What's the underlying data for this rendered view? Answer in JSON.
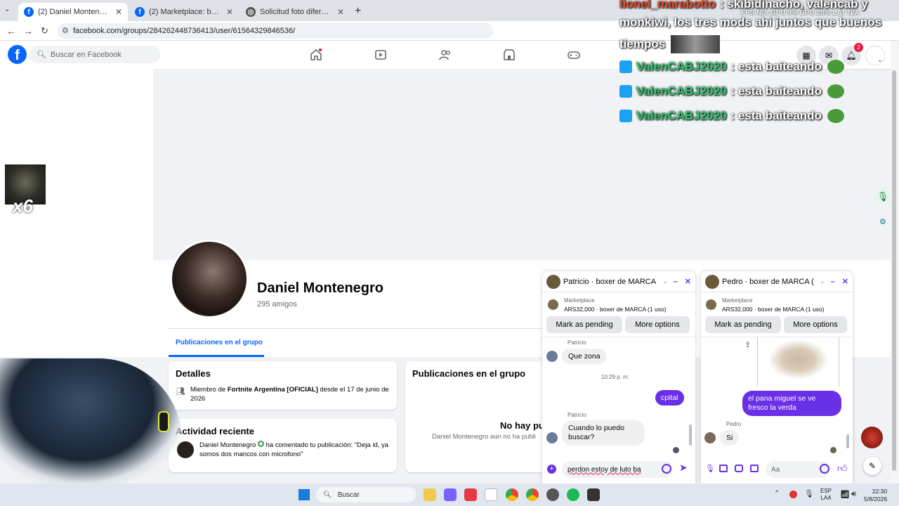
{
  "browser": {
    "tabs": [
      {
        "title": "(2) Daniel Montenegro | Facebook",
        "active": true
      },
      {
        "title": "(2) Marketplace: boxer de MARCA",
        "active": false
      },
      {
        "title": "Solicitud foto diferente",
        "active": false
      }
    ],
    "url": "facebook.com/groups/284262448736413/user/61564329846536/"
  },
  "fb": {
    "search_placeholder": "Buscar en Facebook",
    "notif_count": "2",
    "accent": "#0866ff"
  },
  "profile": {
    "name": "Daniel Montenegro",
    "friends": "295 amigos",
    "tab_active": "Publicaciones en el grupo"
  },
  "details": {
    "title": "Detalles",
    "member_prefix": "Miembro de ",
    "member_group": "Fortnite Argentina [OFICIAL]",
    "member_suffix": " desde el 17 de junio de 2026"
  },
  "activity": {
    "title": "Actividad reciente",
    "actor": "Daniel Montenegro",
    "action": " ha comentado tu publicación: \"Deja id, ya somos dos mancos con microfono\""
  },
  "posts": {
    "title": "Publicaciones en el grupo",
    "empty_title": "No hay pu",
    "empty_sub": "Daniel Montenegro aún no ha publi"
  },
  "chat1": {
    "title": "Patricio · boxer de MARCA...",
    "market_label": "Marketplace",
    "market_item": "ARS32,000 · boxer de MARCA (1 uso)",
    "btn_pending": "Mark as pending",
    "btn_more": "More options",
    "sender": "Patricio",
    "msg1": "Que zona",
    "time": "10:29 p. m.",
    "msg_out": "cpital",
    "msg2": "Cuando lo puedo buscar?",
    "draft": "perdon estoy de luto ba"
  },
  "chat2": {
    "title": "Pedro · boxer de MARCA (...",
    "market_label": "Marketplace",
    "market_item": "ARS32,000 · boxer de MARCA (1 uso)",
    "btn_pending": "Mark as pending",
    "btn_more": "More options",
    "msg_out": "el pana miguel se ve fresco la verda",
    "sender": "Pedro",
    "msg1": "Si",
    "input_placeholder": "Aa"
  },
  "overlay": {
    "line1_user": "lionel_marabotto",
    "line1_text": ": skibidinacho, valencab y",
    "line2_text": "monkiwi, los tres mods ahi juntos que buenos",
    "line3_text": "tiempos",
    "repeat_user": "ValenCABJ2020",
    "repeat_text": ": esta baiteando",
    "stats": "FPS N/A   GPU 9%   CPU 28%   LAT N/A",
    "combo": "x6"
  },
  "taskbar": {
    "search": "Buscar",
    "lang1": "ESP",
    "lang2": "LAA",
    "time": "22:30",
    "date": "5/8/2026"
  }
}
